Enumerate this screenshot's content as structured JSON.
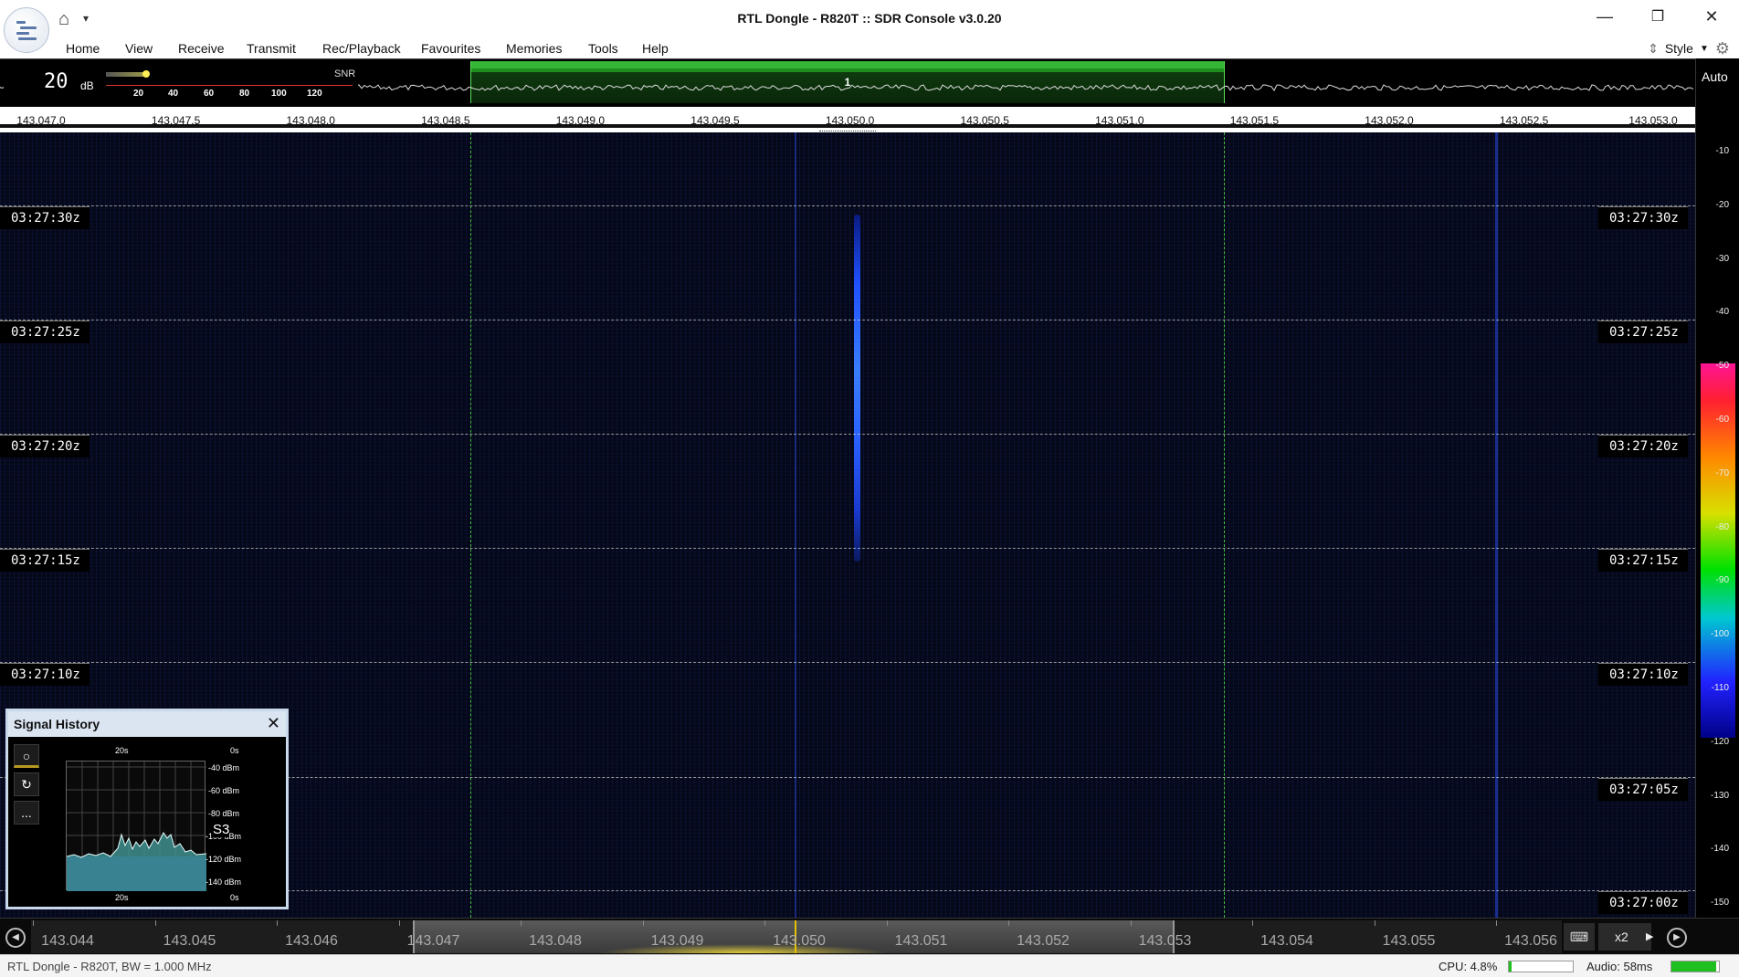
{
  "window": {
    "title": "RTL Dongle - R820T :: SDR Console v3.0.20",
    "minimize_icon": "minimize-icon",
    "maximize_icon": "restore-icon",
    "close_icon": "close-icon"
  },
  "quick_access": {
    "home_icon": "home-icon",
    "more_icon": "dropdown-arrow-icon"
  },
  "menu": [
    "Home",
    "View",
    "Receive",
    "Transmit",
    "Rec/Playback",
    "Favourites",
    "Memories",
    "Tools",
    "Help"
  ],
  "style_menu": {
    "label": "Style",
    "icon": "settings-gear-icon"
  },
  "smeter": {
    "value": "20",
    "unit": "dB",
    "mode": "SNR",
    "scale": [
      "20",
      "40",
      "60",
      "80",
      "100",
      "120"
    ],
    "level_fraction": 0.17
  },
  "spectrum": {
    "band_number": "1",
    "freq_labels": [
      "143.047.0",
      "143.047.5",
      "143.048.0",
      "143.048.5",
      "143.049.0",
      "143.049.5",
      "143.050.0",
      "143.050.5",
      "143.051.0",
      "143.051.5",
      "143.052.0",
      "143.052.5",
      "143.053.0"
    ],
    "band_color": "#35b535"
  },
  "waterfall": {
    "timestamps": [
      "03:27:30z",
      "03:27:25z",
      "03:27:20z",
      "03:27:15z",
      "03:27:10z",
      "03:27:05z",
      "03:27:00z"
    ],
    "signal_color": "#2f6cff",
    "background_color": "#050818"
  },
  "db_scale": {
    "auto_label": "Auto",
    "ticks": [
      "-10",
      "-20",
      "-30",
      "-40",
      "-50",
      "-60",
      "-70",
      "-80",
      "-90",
      "-100",
      "-110",
      "-120",
      "-130",
      "-140",
      "-150"
    ]
  },
  "signal_history": {
    "title": "Signal History",
    "close_icon": "close-icon",
    "buttons": [
      "record-icon",
      "refresh-icon",
      "more-icon"
    ],
    "buttons_text": [
      "○",
      "↻",
      "..."
    ],
    "time_top_left": "20s",
    "time_top_right": "0s",
    "time_bottom_left": "20s",
    "time_bottom_right": "0s",
    "levels": [
      "-40 dBm",
      "-60 dBm",
      "-80 dBm",
      "-100 dBm",
      "-120 dBm",
      "-140 dBm"
    ],
    "s_level": "S3"
  },
  "bottom_scale": {
    "labels": [
      "143.044",
      "143.045",
      "143.046",
      "143.047",
      "143.048",
      "143.049",
      "143.050",
      "143.051",
      "143.052",
      "143.053",
      "143.054",
      "143.055",
      "143.056"
    ],
    "zoom": "x2",
    "left_icon": "scroll-left-icon",
    "right_icon": "scroll-right-icon",
    "keyboard_icon": "keyboard-icon"
  },
  "status": {
    "device": "RTL Dongle - R820T, BW = 1.000 MHz",
    "cpu": "CPU: 4.8%",
    "cpu_fraction": 0.048,
    "audio": "Audio: 58ms",
    "audio_fraction": 0.95
  }
}
